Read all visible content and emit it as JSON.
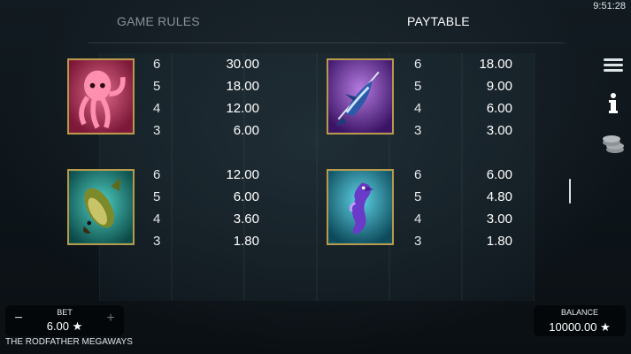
{
  "status": {
    "clock": "9:51:28"
  },
  "tabs": {
    "game_rules": "GAME RULES",
    "paytable": "PAYTABLE",
    "active": "PAYTABLE"
  },
  "paytable": [
    {
      "symbol": "octopus",
      "rows": [
        {
          "count": "6",
          "value": "30.00"
        },
        {
          "count": "5",
          "value": "18.00"
        },
        {
          "count": "4",
          "value": "12.00"
        },
        {
          "count": "3",
          "value": "6.00"
        }
      ]
    },
    {
      "symbol": "marlin",
      "rows": [
        {
          "count": "6",
          "value": "18.00"
        },
        {
          "count": "5",
          "value": "9.00"
        },
        {
          "count": "4",
          "value": "6.00"
        },
        {
          "count": "3",
          "value": "3.00"
        }
      ]
    },
    {
      "symbol": "bass",
      "rows": [
        {
          "count": "6",
          "value": "12.00"
        },
        {
          "count": "5",
          "value": "6.00"
        },
        {
          "count": "4",
          "value": "3.60"
        },
        {
          "count": "3",
          "value": "1.80"
        }
      ]
    },
    {
      "symbol": "seahorse",
      "rows": [
        {
          "count": "6",
          "value": "6.00"
        },
        {
          "count": "5",
          "value": "4.80"
        },
        {
          "count": "4",
          "value": "3.00"
        },
        {
          "count": "3",
          "value": "1.80"
        }
      ]
    }
  ],
  "side_menu": [
    "menu-icon",
    "info-icon",
    "coins-icon"
  ],
  "bet": {
    "label": "BET",
    "value": "6.00 ★",
    "minus": "−",
    "plus": "+"
  },
  "balance": {
    "label": "BALANCE",
    "value": "10000.00 ★"
  },
  "game_name": "THE RODFATHER MEGAWAYS",
  "colors": {
    "frame_gold": "#b79a4a",
    "octopus_bg": "#b8325f",
    "marlin_bg": "#6a2f9a",
    "bass_bg": "#1f8f86",
    "seahorse_bg": "#1e8aa0"
  }
}
